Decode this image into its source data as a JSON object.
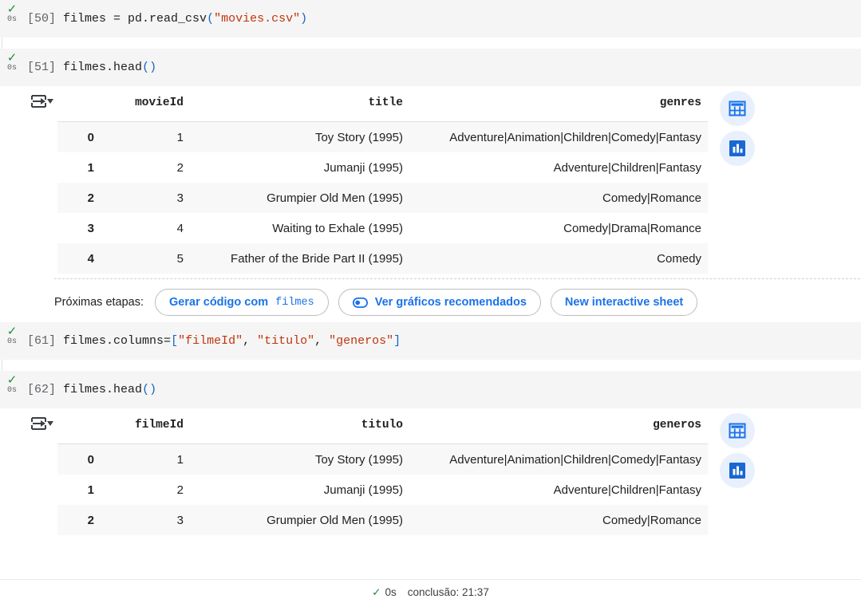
{
  "cells": [
    {
      "prompt": "[50]",
      "status_check": "✓",
      "status_time": "0s",
      "code_tokens": [
        {
          "t": "filmes = pd.read_csv",
          "c": "plain"
        },
        {
          "t": "(",
          "c": "paren"
        },
        {
          "t": "\"movies.csv\"",
          "c": "str"
        },
        {
          "t": ")",
          "c": "paren"
        }
      ]
    },
    {
      "prompt": "[51]",
      "status_check": "✓",
      "status_time": "0s",
      "code_tokens": [
        {
          "t": "filmes.head",
          "c": "plain"
        },
        {
          "t": "()",
          "c": "paren"
        }
      ]
    },
    {
      "prompt": "[61]",
      "status_check": "✓",
      "status_time": "0s",
      "code_tokens": [
        {
          "t": "filmes.columns=",
          "c": "plain"
        },
        {
          "t": "[",
          "c": "brk"
        },
        {
          "t": "\"filmeId\"",
          "c": "str"
        },
        {
          "t": ", ",
          "c": "plain"
        },
        {
          "t": "\"titulo\"",
          "c": "str"
        },
        {
          "t": ", ",
          "c": "plain"
        },
        {
          "t": "\"generos\"",
          "c": "str"
        },
        {
          "t": "]",
          "c": "brk"
        }
      ]
    },
    {
      "prompt": "[62]",
      "status_check": "✓",
      "status_time": "0s",
      "code_tokens": [
        {
          "t": "filmes.head",
          "c": "plain"
        },
        {
          "t": "()",
          "c": "paren"
        }
      ]
    }
  ],
  "dataframe_1": {
    "index_header": "",
    "columns": [
      "movieId",
      "title",
      "genres"
    ],
    "index": [
      "0",
      "1",
      "2",
      "3",
      "4"
    ],
    "rows": [
      [
        "1",
        "Toy Story (1995)",
        "Adventure|Animation|Children|Comedy|Fantasy"
      ],
      [
        "2",
        "Jumanji (1995)",
        "Adventure|Children|Fantasy"
      ],
      [
        "3",
        "Grumpier Old Men (1995)",
        "Comedy|Romance"
      ],
      [
        "4",
        "Waiting to Exhale (1995)",
        "Comedy|Drama|Romance"
      ],
      [
        "5",
        "Father of the Bride Part II (1995)",
        "Comedy"
      ]
    ]
  },
  "dataframe_2": {
    "index_header": "",
    "columns": [
      "filmeId",
      "titulo",
      "generos"
    ],
    "index": [
      "0",
      "1",
      "2"
    ],
    "rows": [
      [
        "1",
        "Toy Story (1995)",
        "Adventure|Animation|Children|Comedy|Fantasy"
      ],
      [
        "2",
        "Jumanji (1995)",
        "Adventure|Children|Fantasy"
      ],
      [
        "3",
        "Grumpier Old Men (1995)",
        "Comedy|Romance"
      ]
    ]
  },
  "next_steps": {
    "label": "Próximas etapas:",
    "chip_generate_prefix": "Gerar código com ",
    "chip_generate_var": "filmes",
    "chip_recommended_charts": "Ver gráficos recomendados",
    "chip_new_sheet": "New interactive sheet"
  },
  "side_icons": {
    "table_view": "table-view-icon",
    "chart_view": "chart-view-icon"
  },
  "toolbar_icons": {
    "sort_filter": "sort-filter-icon"
  },
  "footer": {
    "check": "✓",
    "seconds": "0s",
    "completion": "conclusão: 21:37"
  },
  "colors": {
    "accent_blue": "#1a73e8",
    "icon_bg": "#e8f0fe",
    "code_bg": "#f5f5f5",
    "row_stripe": "#f8f8f8",
    "green_check": "#1e8e3e",
    "string_red": "#bf360c"
  }
}
